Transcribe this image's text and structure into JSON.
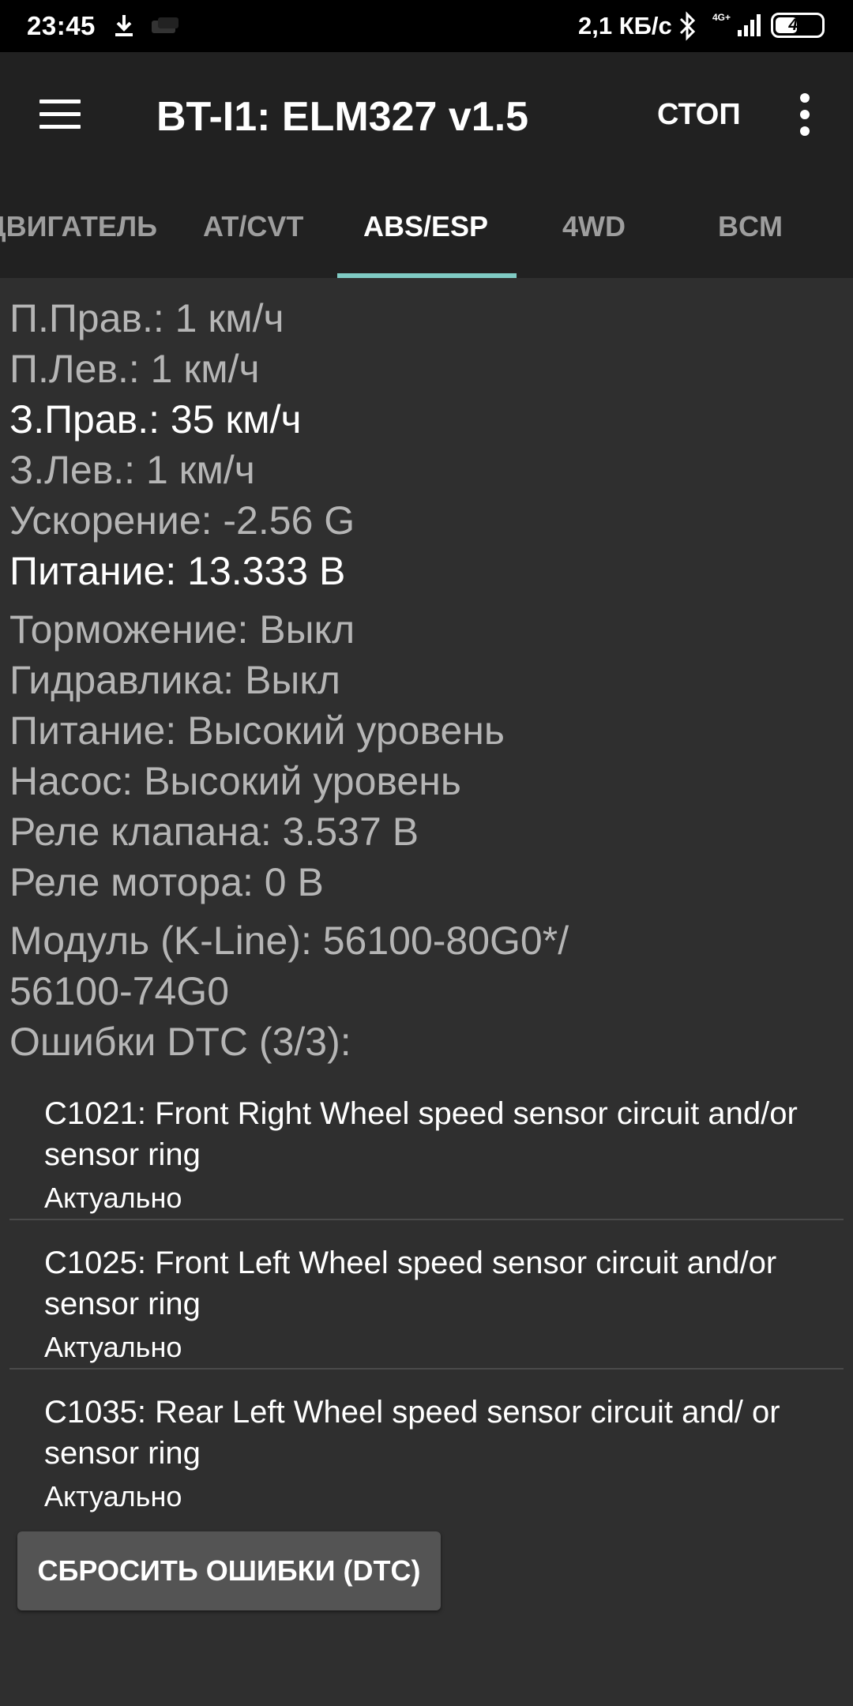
{
  "status_bar": {
    "time": "23:45",
    "speed": "2,1 КБ/с",
    "network": "4G+",
    "battery": "49",
    "battery_percent": 49
  },
  "toolbar": {
    "title": "BT-I1: ELM327 v1.5",
    "stop_label": "СТОП",
    "menu_icon": "hamburger-menu-icon",
    "overflow_icon": "more-vert-icon"
  },
  "tabs": [
    {
      "label": "ДВИГАТЕЛЬ",
      "active": false
    },
    {
      "label": "AT/CVT",
      "active": false
    },
    {
      "label": "ABS/ESP",
      "active": true
    },
    {
      "label": "4WD",
      "active": false
    },
    {
      "label": "BCM",
      "active": false
    }
  ],
  "params": [
    "П.Прав.: 1 км/ч",
    "П.Лев.: 1 км/ч",
    "З.Прав.: 35 км/ч",
    "З.Лев.: 1 км/ч",
    "Ускорение: -2.56 G",
    "Питание: 13.333 В",
    "Торможение: Выкл",
    "Гидравлика: Выкл",
    "Питание: Высокий уровень",
    "Насос: Высокий уровень",
    "Реле клапана: 3.537 В",
    "Реле мотора: 0 В",
    "Модуль (K-Line): 56100-80G0*/",
    "56100-74G0",
    "Ошибки DTC (3/3):"
  ],
  "dtc": [
    {
      "code_text": "C1021: Front Right Wheel speed sensor circuit and/or sensor ring",
      "status": "Актуально"
    },
    {
      "code_text": "C1025: Front Left Wheel speed sensor circuit and/or sensor ring",
      "status": "Актуально"
    },
    {
      "code_text": "C1035: Rear Left Wheel speed sensor circuit and/ or sensor ring",
      "status": "Актуально"
    }
  ],
  "reset_button_label": "СБРОСИТЬ ОШИБКИ (DTC)",
  "colors": {
    "background": "#2f2f2f",
    "toolbar": "#212121",
    "tab_indicator": "#80cbc4",
    "button": "#545454"
  }
}
